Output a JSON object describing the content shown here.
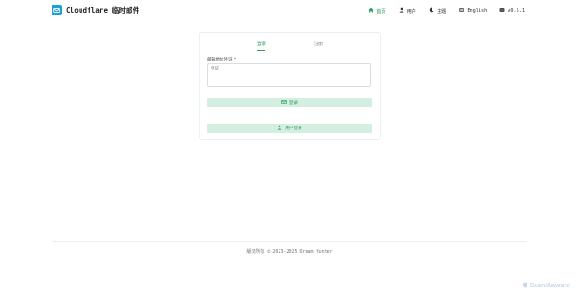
{
  "header": {
    "brand_title": "Cloudflare 临时邮件",
    "nav": [
      {
        "label": "首页",
        "icon": "home-icon",
        "active": true
      },
      {
        "label": "用户",
        "icon": "user-icon"
      },
      {
        "label": "主题",
        "icon": "moon-icon"
      },
      {
        "label": "English",
        "icon": "translate-icon"
      },
      {
        "label": "v0.5.1",
        "icon": "github-icon"
      }
    ]
  },
  "card": {
    "tabs": [
      "登录",
      "注册"
    ],
    "active_tab": 0,
    "field_label": "邮箱地址凭证",
    "field_required": "*",
    "textarea_placeholder": "凭证",
    "primary_button": "登录",
    "secondary_button": "用户登录"
  },
  "footer": {
    "text": "版权所有 © 2023-2025 Dream Hunter"
  },
  "watermark": {
    "text": "ScanMalware"
  },
  "colors": {
    "accent": "#2f9e64",
    "brand_icon": "#1f9ed8",
    "button_bg": "#d4efe1"
  }
}
